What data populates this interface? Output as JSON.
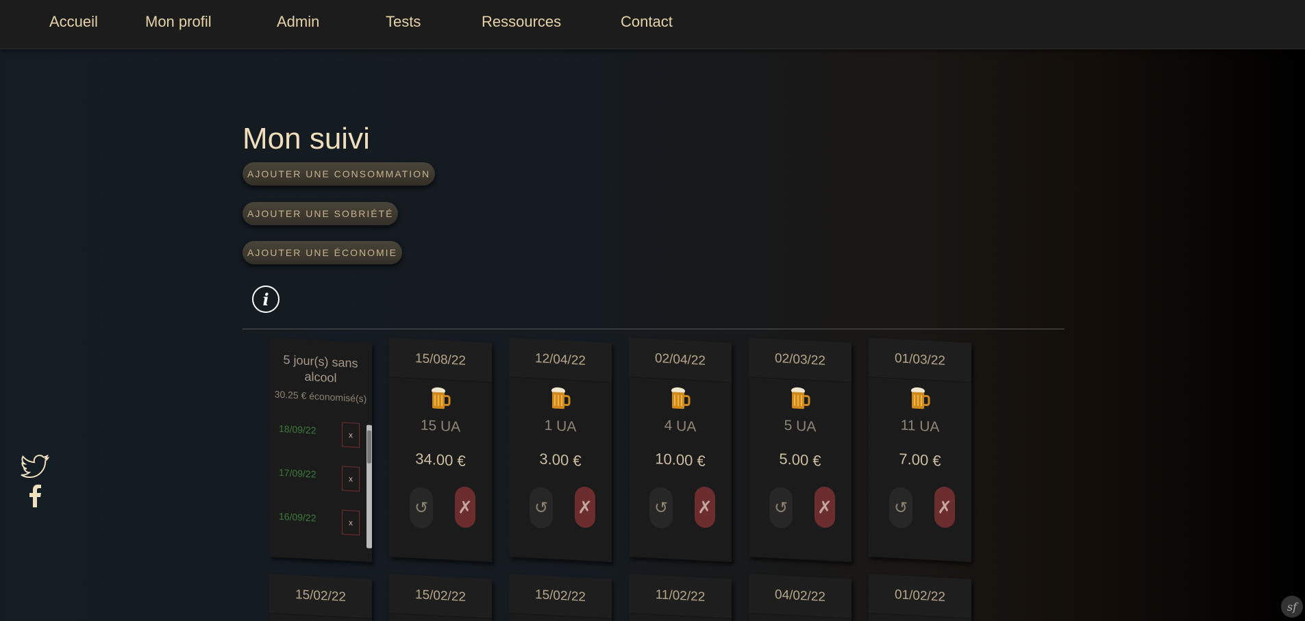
{
  "nav": {
    "items": [
      "Accueil",
      "Mon profil",
      "Admin",
      "Tests",
      "Ressources",
      "Contact"
    ]
  },
  "page": {
    "title": "Mon suivi",
    "add_consumption": "AJOUTER UNE CONSOMMATION",
    "add_sobriety": "AJOUTER UNE SOBRIÉTÉ",
    "add_saving": "AJOUTER UNE ÉCONOMIE",
    "info_icon": "i"
  },
  "streak": {
    "title": "5 jour(s) sans alcool",
    "saved": "30.25 € économisé(s)",
    "dates": [
      "18/09/22",
      "17/09/22",
      "16/09/22"
    ],
    "delete_label": "x"
  },
  "cards": [
    {
      "date": "15/08/22",
      "ua": "15 UA",
      "price": "34.00 €"
    },
    {
      "date": "12/04/22",
      "ua": "1 UA",
      "price": "3.00 €"
    },
    {
      "date": "02/04/22",
      "ua": "4 UA",
      "price": "10.00 €"
    },
    {
      "date": "02/03/22",
      "ua": "5 UA",
      "price": "5.00 €"
    },
    {
      "date": "01/03/22",
      "ua": "11 UA",
      "price": "7.00 €"
    }
  ],
  "second_row_dates": [
    "15/02/22",
    "15/02/22",
    "15/02/22",
    "11/02/22",
    "04/02/22",
    "01/02/22"
  ],
  "actions": {
    "reset_icon": "↺",
    "delete_icon": "✗"
  },
  "colors": {
    "accent": "#e6d2a6",
    "delete": "#6b2d2d",
    "date_green": "#3f7a39"
  },
  "icons": [
    "twitter-icon",
    "facebook-icon",
    "beer-icon",
    "info-icon",
    "symfony-icon"
  ]
}
